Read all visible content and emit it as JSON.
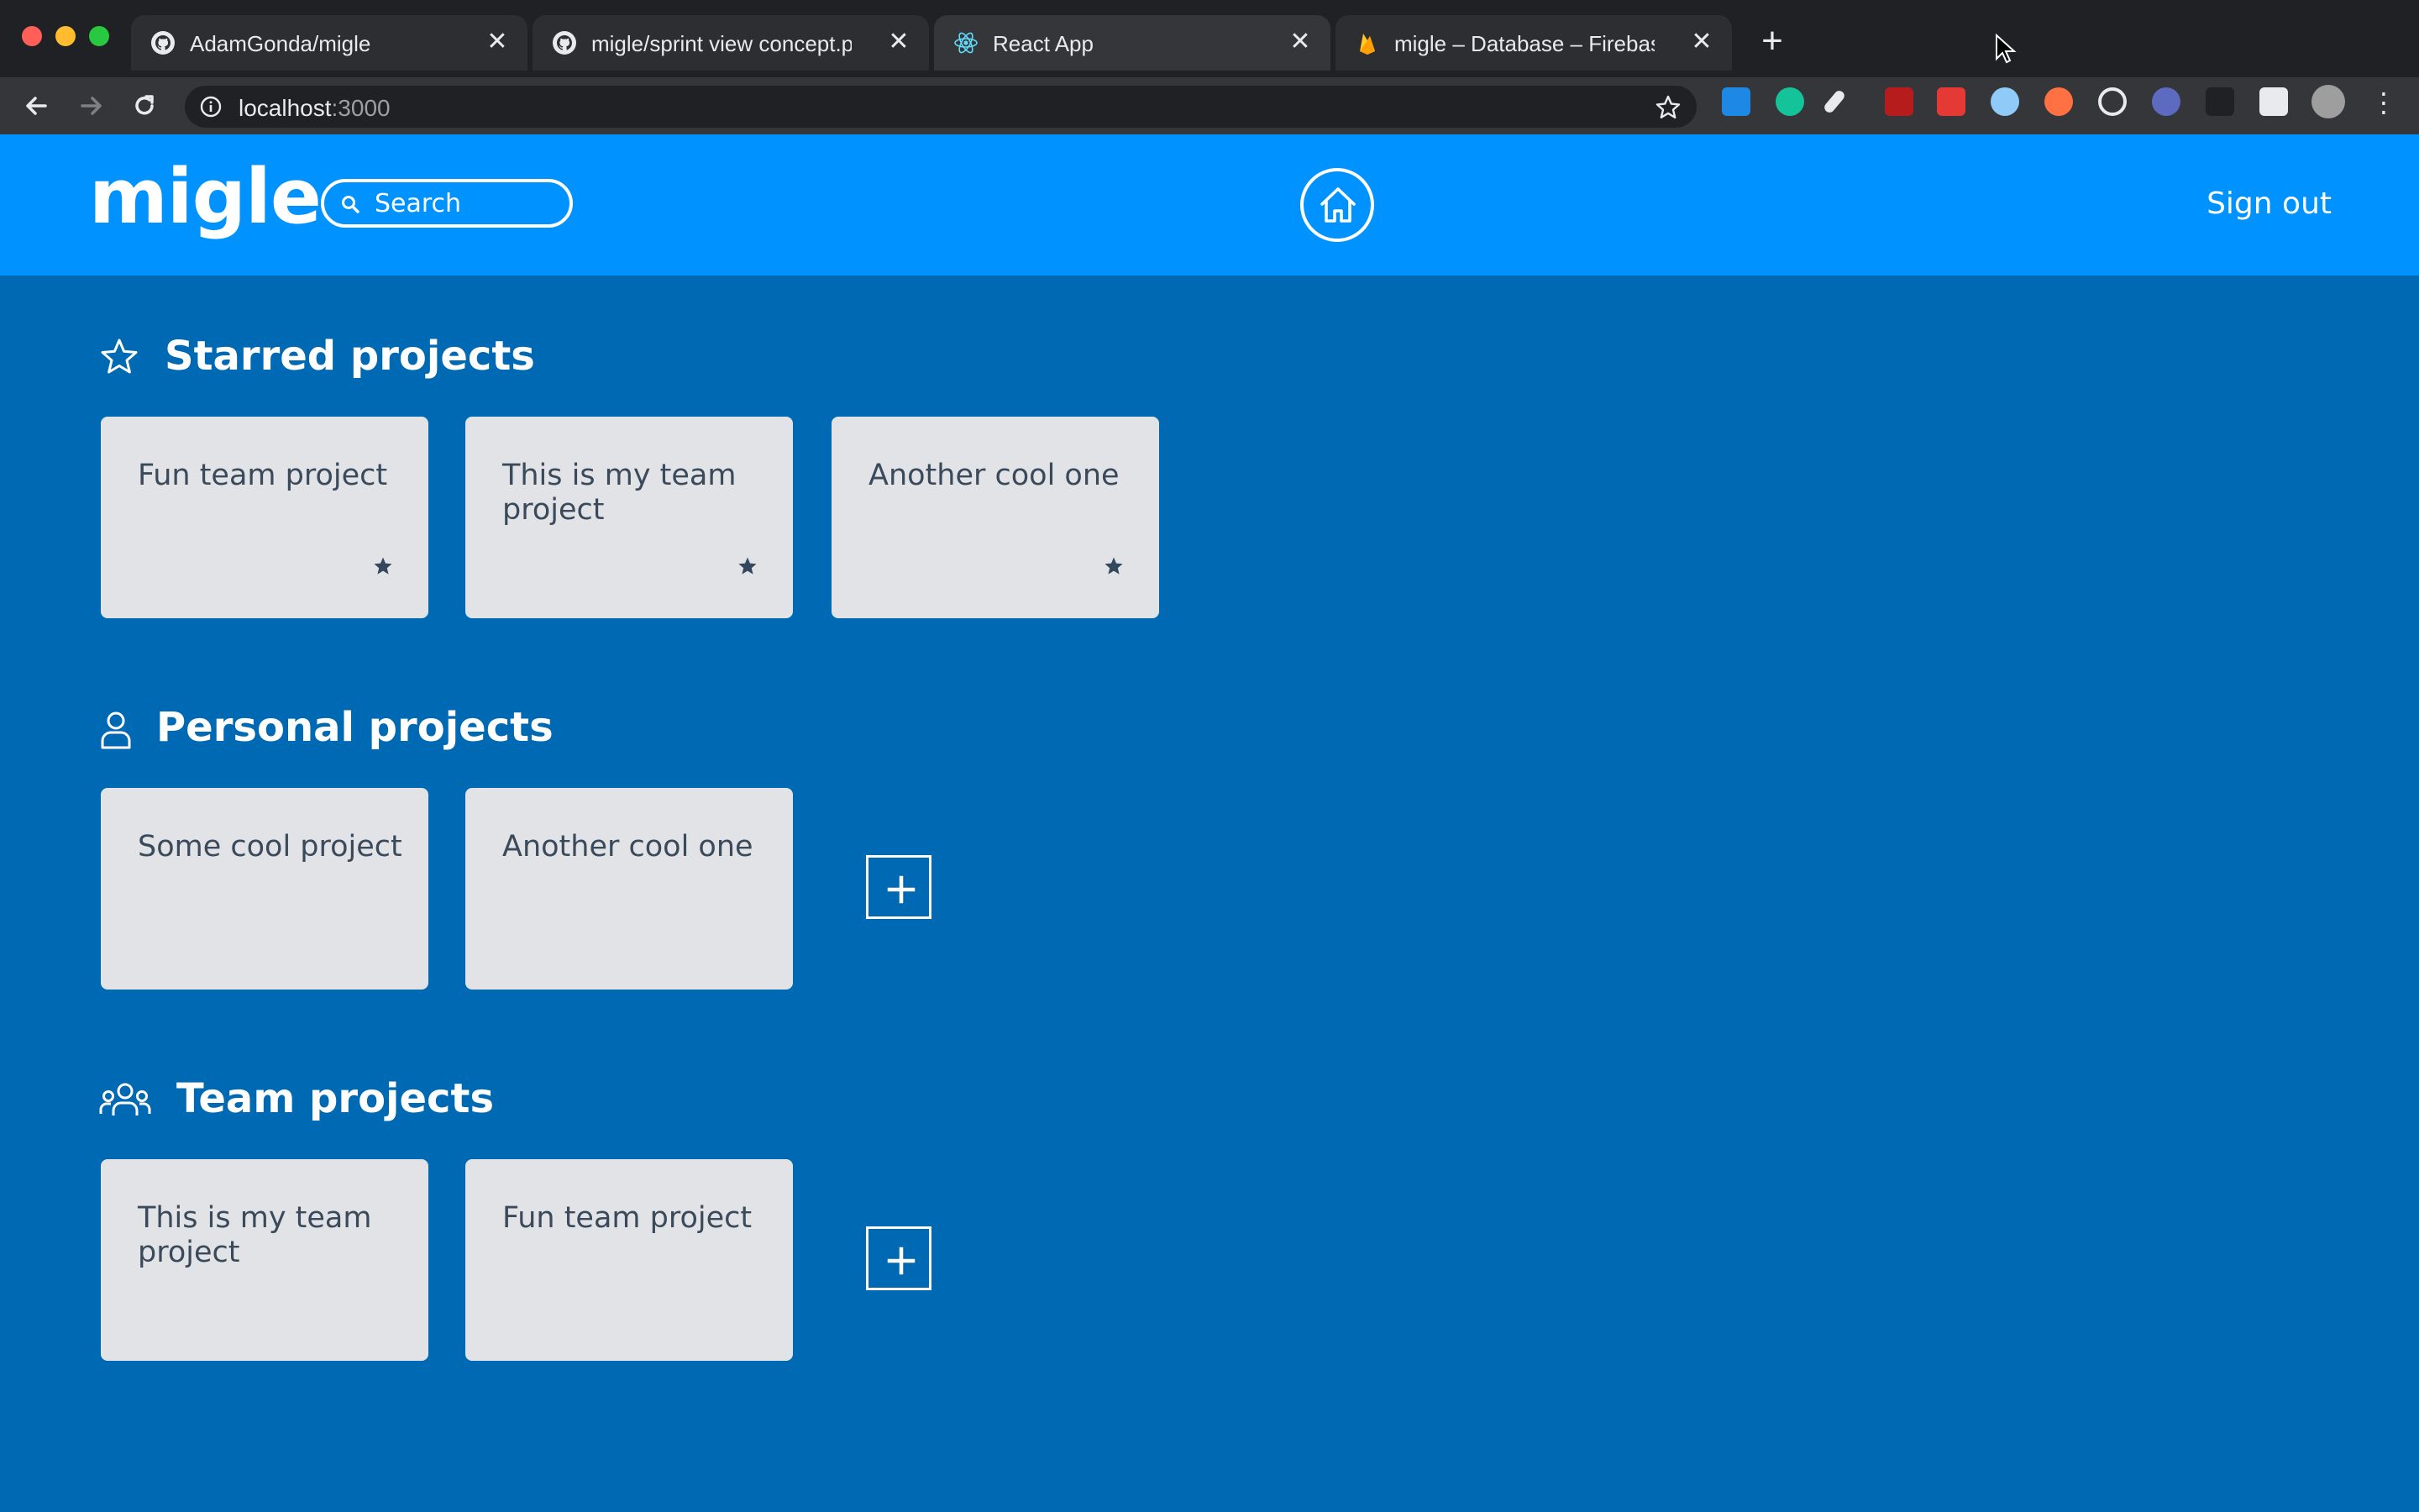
{
  "browser": {
    "tabs": [
      {
        "title": "AdamGonda/migle",
        "icon": "github-icon"
      },
      {
        "title": "migle/sprint view concept.png",
        "icon": "github-icon"
      },
      {
        "title": "React App",
        "icon": "react-icon"
      },
      {
        "title": "migle – Database – Firebase co",
        "icon": "firebase-icon"
      }
    ],
    "close_glyph": "✕",
    "new_tab_glyph": "+",
    "url_host": "localhost",
    "url_port": ":3000",
    "menu_glyph": "⋮"
  },
  "header": {
    "logo": "migle",
    "search_placeholder": "Search",
    "sign_out": "Sign out"
  },
  "sections": {
    "starred": {
      "title": "Starred projects",
      "cards": [
        "Fun team project",
        "This is my team project",
        "Another cool one"
      ]
    },
    "personal": {
      "title": "Personal projects",
      "cards": [
        "Some cool project",
        "Another cool one"
      ]
    },
    "team": {
      "title": "Team projects",
      "cards": [
        "This is my team project",
        "Fun team project"
      ]
    }
  },
  "colors": {
    "page_bg": "#0069b4",
    "header_bg": "#0092ff",
    "card_bg": "#e1e3e7",
    "card_text": "#3b4a5a"
  }
}
